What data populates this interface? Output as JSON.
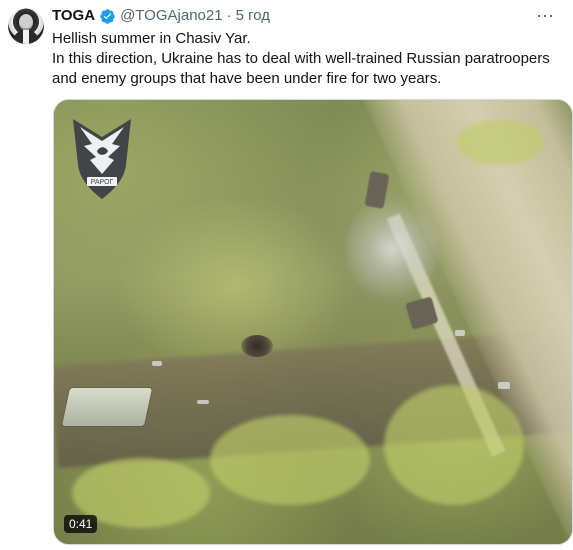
{
  "author": {
    "display_name": "TOGA",
    "handle": "@TOGAjano21",
    "separator": "·",
    "time": "5 год",
    "verified_badge_icon": "verified-badge-icon",
    "avatar_icon": "avatar-image"
  },
  "tweet": {
    "lines": [
      "Hellish summer in Chasiv Yar.",
      "In this direction, Ukraine has to deal with well-trained Russian paratroopers",
      "and enemy groups that have been under fire for two years."
    ]
  },
  "media": {
    "duration": "0:41",
    "watermark_icon": "raptor-logo-icon",
    "watermark_text": "РАРОГ"
  },
  "actions": {
    "more_icon": "more-options-icon",
    "more_label": "⋯"
  },
  "colors": {
    "primary_text": "#0f1419",
    "secondary_text": "#536471",
    "verified_blue": "#1d9bf0",
    "border": "#cfd9de"
  }
}
